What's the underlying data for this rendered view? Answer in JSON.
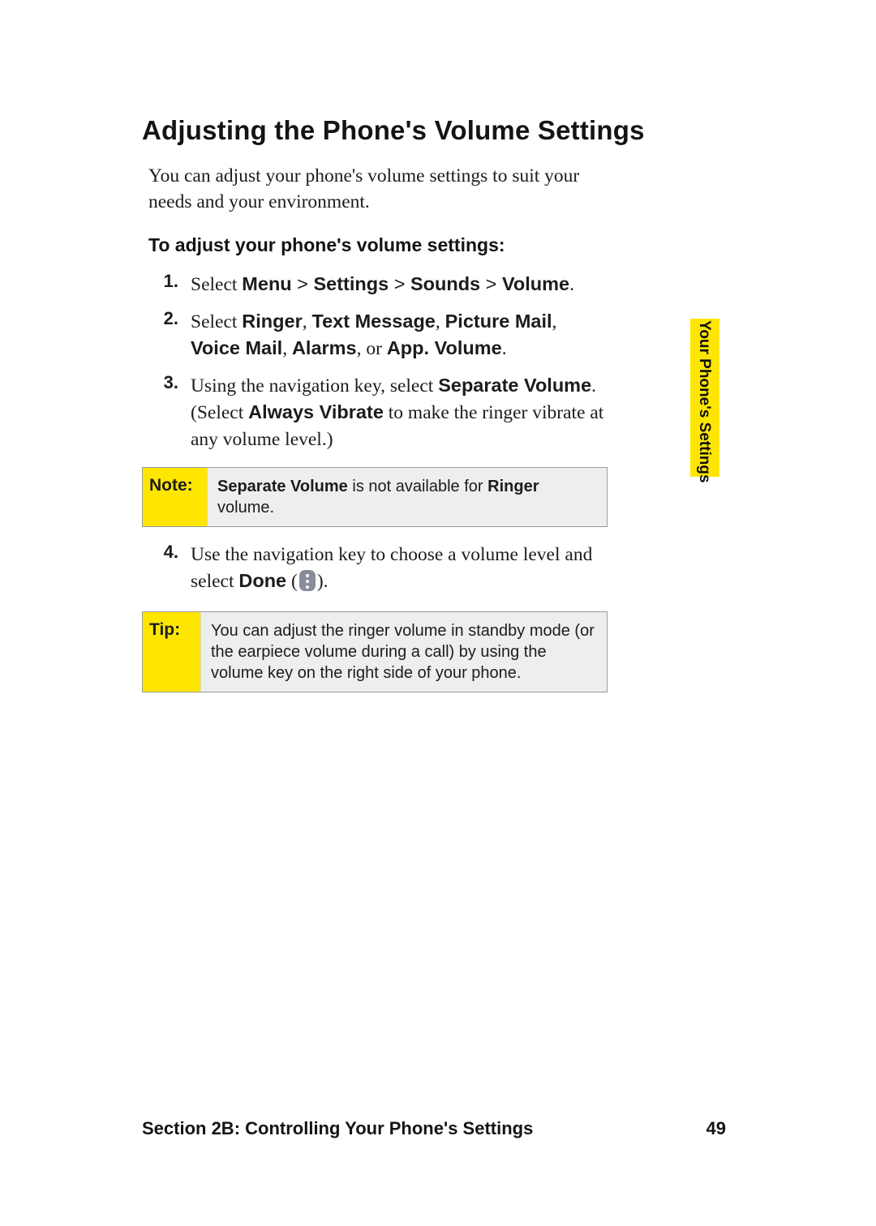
{
  "title": "Adjusting the Phone's Volume Settings",
  "intro": "You can adjust your phone's volume settings to suit your needs and your environment.",
  "instr_head": "To adjust your phone's volume settings:",
  "steps": {
    "n1": "1.",
    "s1_a": "Select ",
    "s1_menu": "Menu",
    "s1_gt1": " > ",
    "s1_settings": "Settings",
    "s1_gt2": " > ",
    "s1_sounds": "Sounds",
    "s1_gt3": " > ",
    "s1_volume": "Volume",
    "s1_end": ".",
    "n2": "2.",
    "s2_a": "Select ",
    "s2_ringer": "Ringer",
    "s2_c1": ", ",
    "s2_text": "Text Message",
    "s2_c2": ", ",
    "s2_pic": "Picture Mail",
    "s2_c3": ", ",
    "s2_vm": "Voice Mail",
    "s2_c4": ", ",
    "s2_alarms": "Alarms",
    "s2_or": ", or ",
    "s2_app": "App. Volume",
    "s2_end": ".",
    "n3": "3.",
    "s3_a": "Using the navigation key, select ",
    "s3_sep": "Separate Volume",
    "s3_b": ". (Select ",
    "s3_av": "Always Vibrate",
    "s3_c": " to make the ringer vibrate at any volume level.)",
    "n4": "4.",
    "s4_a": "Use the navigation key to choose a volume level and select ",
    "s4_done": "Done",
    "s4_paren_open": " (",
    "s4_paren_close": ")."
  },
  "note": {
    "label": "Note:",
    "b1": "Separate Volume",
    "mid": " is not available for ",
    "b2": "Ringer",
    "end": " volume."
  },
  "tip": {
    "label": "Tip:",
    "text": "You can adjust the ringer volume in standby mode (or the earpiece volume during a call) by using the volume key on the right side of your phone."
  },
  "side_tab": "Your Phone's Settings",
  "footer": {
    "title": "Section 2B: Controlling Your Phone's Settings",
    "page": "49"
  }
}
